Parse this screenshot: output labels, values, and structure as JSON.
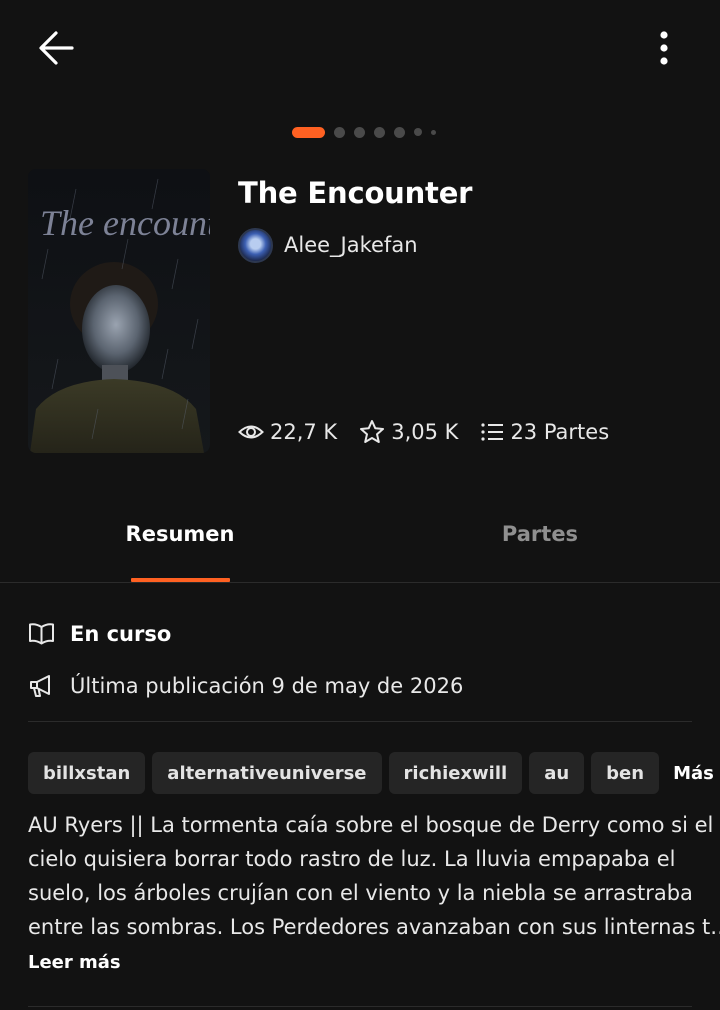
{
  "header": {
    "back_icon": "arrow-left-icon",
    "more_icon": "more-vertical-icon"
  },
  "carousel": {
    "active_index": 0,
    "dot_count": 7,
    "accent_color": "#ff6122"
  },
  "story": {
    "cover_title_text": "The encounter",
    "title": "The Encounter",
    "author": "Alee_Jakefan",
    "stats": {
      "reads": "22,7 K",
      "votes": "3,05 K",
      "parts": "23 Partes"
    }
  },
  "tabs": [
    {
      "label": "Resumen",
      "active": true
    },
    {
      "label": "Partes",
      "active": false
    }
  ],
  "details": {
    "status": "En curso",
    "last_published": "Última publicación 9 de may de 2026"
  },
  "tags": {
    "items": [
      "billxstan",
      "alternativeuniverse",
      "richiexwill",
      "au",
      "ben"
    ],
    "more_label": "Más"
  },
  "description": {
    "lines": [
      "AU Ryers || La tormenta caía sobre el bosque de Derry como si el",
      "cielo quisiera borrar todo rastro de luz. La lluvia empapaba el",
      "suelo, los árboles crujían con el viento y la niebla se arrastraba",
      "entre las sombras. Los Perdedores avanzaban con sus linternas t…"
    ],
    "read_more_label": "Leer más"
  },
  "colors": {
    "background": "#121212",
    "accent": "#ff6122",
    "chip_background": "#252525",
    "muted_text": "#8f8f8f"
  }
}
